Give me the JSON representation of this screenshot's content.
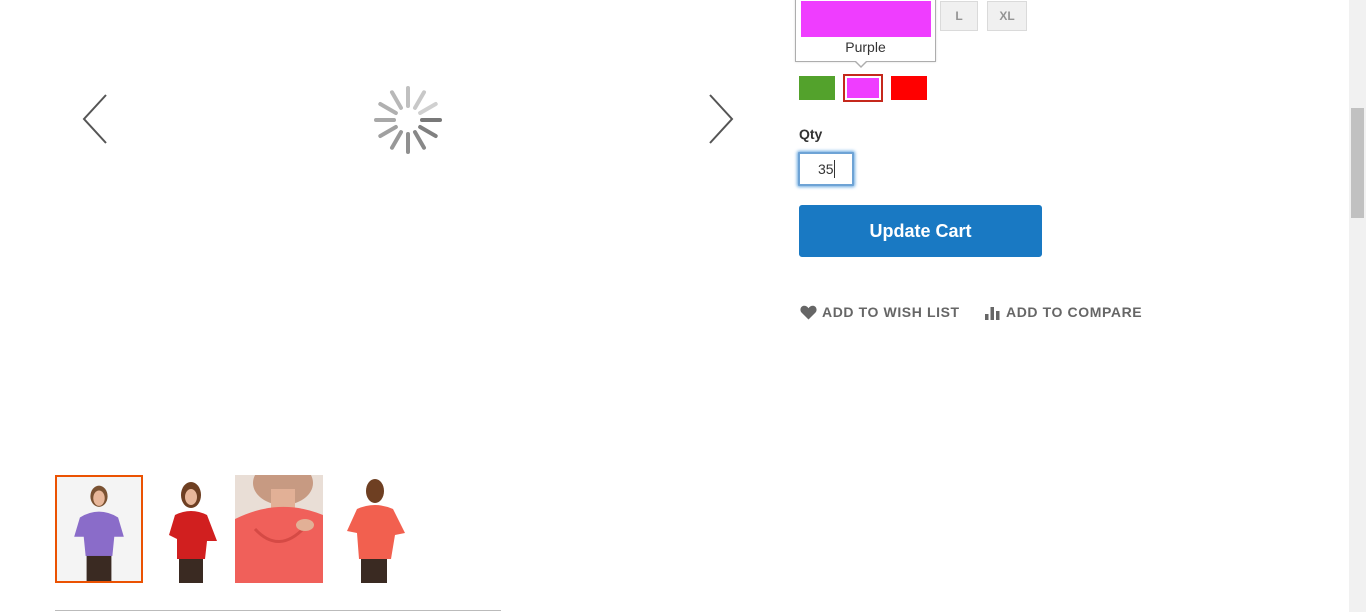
{
  "gallery": {
    "prev_icon": "chevron-left-icon",
    "next_icon": "chevron-right-icon",
    "loader_icon": "loading-spinner-icon",
    "thumbnails": [
      {
        "name": "thumbnail-purple-front",
        "color": "#8a6cc9",
        "active": true
      },
      {
        "name": "thumbnail-red-front",
        "color": "#d11f1f",
        "active": false
      },
      {
        "name": "thumbnail-coral-closeup",
        "color": "#f0605a",
        "active": false
      },
      {
        "name": "thumbnail-coral-back",
        "color": "#f2604f",
        "active": false
      }
    ],
    "active_border_color": "#eb5202"
  },
  "options": {
    "sizes": [
      "L",
      "XL"
    ],
    "tooltip": {
      "label": "Purple",
      "color": "#ef3dff"
    },
    "colors": [
      {
        "label": "Green",
        "hex": "#53a22c",
        "selected": false
      },
      {
        "label": "Purple",
        "hex": "#ef3dff",
        "selected": true
      },
      {
        "label": "Red",
        "hex": "#ff0000",
        "selected": false
      }
    ],
    "selected_border_color": "#c5281c"
  },
  "qty": {
    "label": "Qty",
    "value": "35"
  },
  "actions": {
    "update_cart": "Update Cart",
    "update_cart_color": "#1979c3",
    "wish_list": "Add to Wish List",
    "wish_icon": "heart-icon",
    "compare": "Add to Compare",
    "compare_icon": "bar-chart-icon"
  }
}
